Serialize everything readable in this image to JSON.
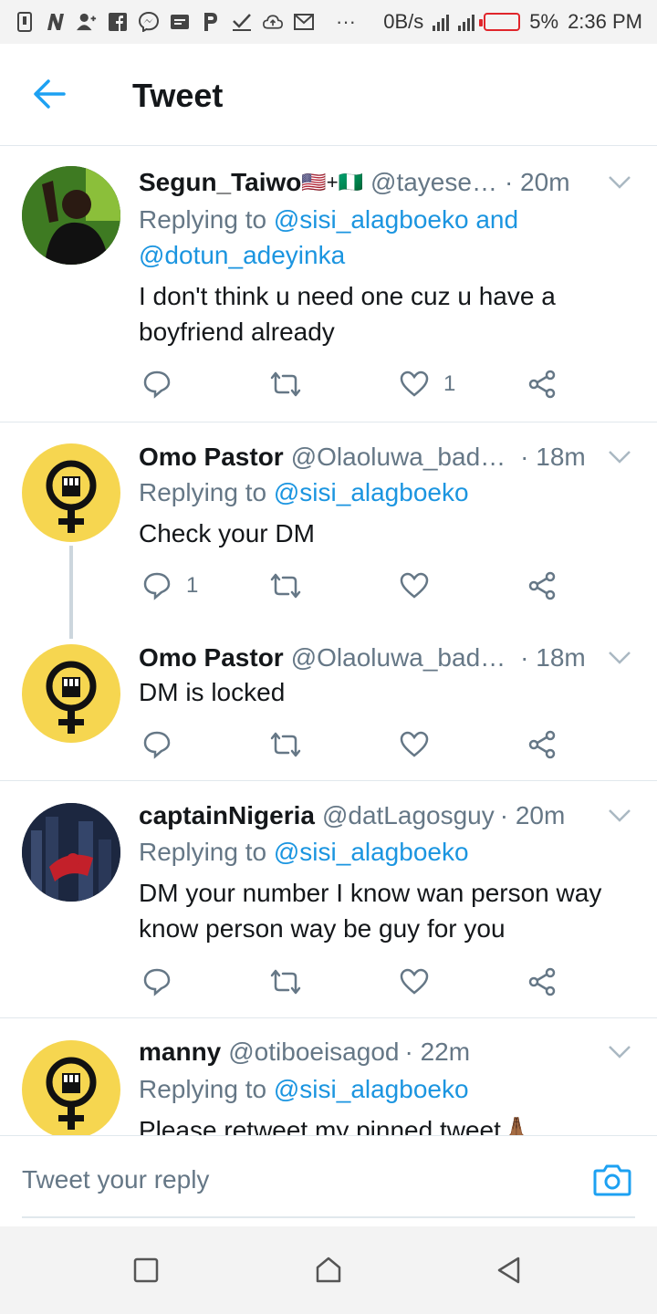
{
  "status_bar": {
    "left_icons": [
      "sim-icon",
      "notification-n-icon",
      "contacts-icon",
      "facebook-icon",
      "messenger-icon",
      "message-icon",
      "p-icon",
      "check-icon",
      "cloud-upload-icon",
      "mail-icon"
    ],
    "more": "···",
    "net_speed": "0B/s",
    "battery": "5%",
    "time": "2:36 PM",
    "battery_color": "#e0252b"
  },
  "header": {
    "title": "Tweet",
    "back_icon": "back-arrow-icon",
    "accent": "#1da1f2"
  },
  "tweets": [
    {
      "name": "Segun_Taiwo",
      "flags": "🇺🇸+🇳🇬",
      "handle": "@tayese…",
      "time": "· 20m",
      "replying_prefix": "Replying to ",
      "replying_mentions": "@sisi_alagboeko",
      "replying_joiner": " and",
      "replying_second": "@dotun_adeyinka",
      "body": "I don't think u need one cuz u have a boyfriend already",
      "reply_count": "",
      "like_count": "1"
    },
    {
      "name": "Omo Pastor",
      "handle": "@Olaoluwa_bad…",
      "time": "· 18m",
      "replying_prefix": "Replying to ",
      "replying_mentions": "@sisi_alagboeko",
      "body": "Check your DM",
      "reply_count": "1",
      "like_count": ""
    },
    {
      "name": "Omo Pastor",
      "handle": "@Olaoluwa_bad…",
      "time": "· 18m",
      "body": "DM is locked",
      "reply_count": "",
      "like_count": ""
    },
    {
      "name": "captainNigeria",
      "handle": "@datLagosguy",
      "time": "· 20m",
      "replying_prefix": "Replying to ",
      "replying_mentions": "@sisi_alagboeko",
      "body": "DM your number I know wan person way know person way be guy for you",
      "reply_count": "",
      "like_count": ""
    },
    {
      "name": "manny",
      "handle": "@otiboeisagod",
      "time": "· 22m",
      "replying_prefix": "Replying to ",
      "replying_mentions": "@sisi_alagboeko",
      "body": "Please retweet my pinned tweet🙏🏾"
    }
  ],
  "composer": {
    "placeholder": "Tweet your reply",
    "camera_icon": "camera-icon"
  },
  "nav": {
    "icons": [
      "recent-apps-icon",
      "home-icon",
      "back-icon"
    ]
  },
  "colors": {
    "mention": "#1b95e0",
    "muted": "#657786",
    "avatar_yellow": "#f6d650",
    "divider": "#e1e8ed"
  }
}
